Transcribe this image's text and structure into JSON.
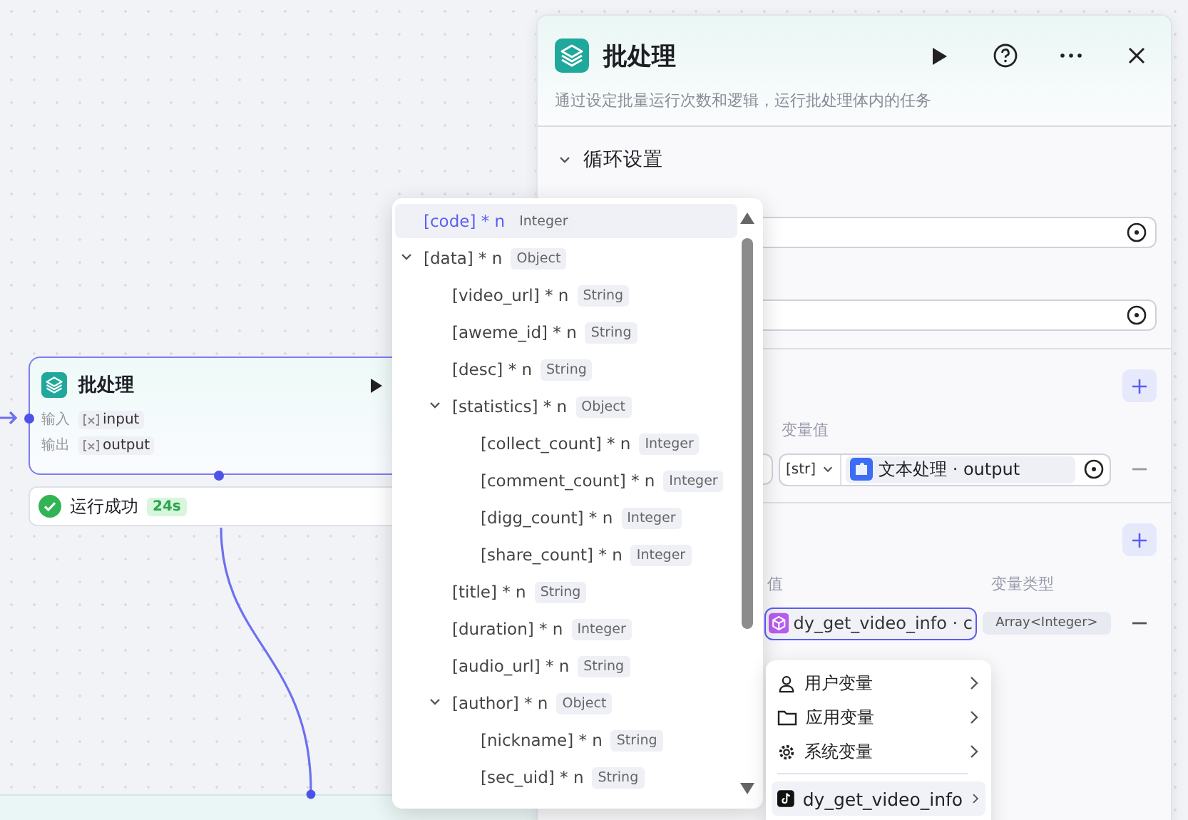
{
  "node": {
    "title": "批处理",
    "ports": [
      {
        "label": "输入",
        "value": "input"
      },
      {
        "label": "输出",
        "value": "output"
      }
    ],
    "status": {
      "text": "运行成功",
      "time": "24s"
    }
  },
  "panel": {
    "title": "批处理",
    "description": "通过设定批量运行次数和逻辑，运行批处理体内的任务",
    "section": {
      "title": "循环设置",
      "expanded": true
    },
    "input_params": {
      "value_label": "变量值",
      "rows": [
        {
          "type_tag": "[str]",
          "value": "文本处理 · output"
        }
      ]
    },
    "output_params": {
      "value_label": "值",
      "type_label": "变量类型",
      "rows": [
        {
          "value": "dy_get_video_info · c",
          "type": "Array<Integer>",
          "selected": true
        }
      ]
    }
  },
  "tree": [
    {
      "name": "[code] * n",
      "type": "Integer",
      "selected": true
    },
    {
      "name": "[data] * n",
      "type": "Object",
      "selected": false,
      "expanded": true,
      "children": [
        {
          "name": "[video_url] * n",
          "type": "String",
          "selected": false
        },
        {
          "name": "[aweme_id] * n",
          "type": "String",
          "selected": false
        },
        {
          "name": "[desc] * n",
          "type": "String",
          "selected": false
        },
        {
          "name": "[statistics] * n",
          "type": "Object",
          "selected": false,
          "expanded": true,
          "children": [
            {
              "name": "[collect_count] * n",
              "type": "Integer",
              "selected": false
            },
            {
              "name": "[comment_count] * n",
              "type": "Integer",
              "selected": false
            },
            {
              "name": "[digg_count] * n",
              "type": "Integer",
              "selected": false
            },
            {
              "name": "[share_count] * n",
              "type": "Integer",
              "selected": false
            }
          ]
        },
        {
          "name": "[title] * n",
          "type": "String",
          "selected": false
        },
        {
          "name": "[duration] * n",
          "type": "Integer",
          "selected": false
        },
        {
          "name": "[audio_url] * n",
          "type": "String",
          "selected": false
        },
        {
          "name": "[author] * n",
          "type": "Object",
          "selected": false,
          "expanded": true,
          "children": [
            {
              "name": "[nickname] * n",
              "type": "String",
              "selected": false
            },
            {
              "name": "[sec_uid] * n",
              "type": "String",
              "selected": false
            }
          ]
        }
      ]
    }
  ],
  "submenu": [
    {
      "label": "用户变量",
      "kind": "user",
      "selected": false
    },
    {
      "label": "应用变量",
      "kind": "app",
      "selected": false
    },
    {
      "label": "系统变量",
      "kind": "system",
      "selected": false
    },
    {
      "label": "dy_get_video_info",
      "kind": "plugin",
      "selected": true
    }
  ]
}
